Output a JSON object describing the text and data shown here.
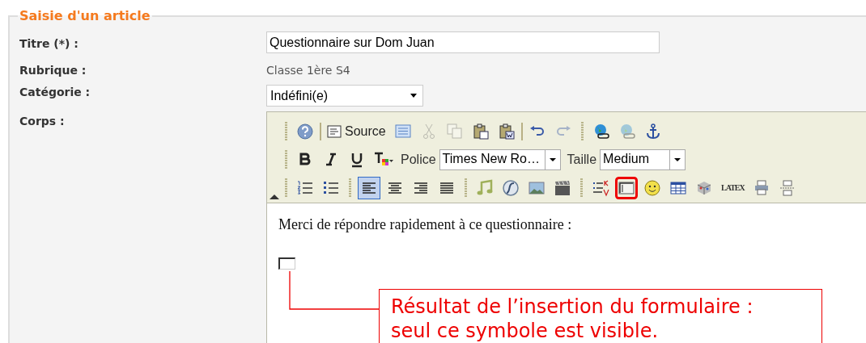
{
  "form": {
    "legend": "Saisie d'un article",
    "fields": [
      {
        "kind": "input",
        "label": "Titre (*) :",
        "value": "Questionnaire sur Dom Juan"
      },
      {
        "kind": "static",
        "label": "Rubrique :",
        "value": "Classe 1ère S4"
      },
      {
        "kind": "select",
        "label": "Catégorie :",
        "value": "Indéfini(e)"
      },
      {
        "kind": "editor",
        "label": "Corps :"
      }
    ]
  },
  "editor": {
    "toolbars": [
      {
        "items": [
          {
            "kind": "grip"
          },
          {
            "kind": "help",
            "on": false,
            "disabled": false,
            "highlighted": false
          },
          {
            "kind": "sep"
          },
          {
            "kind": "source",
            "text": "Source",
            "on": false,
            "disabled": false,
            "highlighted": false
          },
          {
            "kind": "preview",
            "on": false,
            "disabled": false,
            "highlighted": false
          },
          {
            "kind": "cut",
            "on": false,
            "disabled": true,
            "highlighted": false
          },
          {
            "kind": "copy",
            "on": false,
            "disabled": true,
            "highlighted": false
          },
          {
            "kind": "paste",
            "on": false,
            "disabled": false,
            "highlighted": false
          },
          {
            "kind": "pasteword",
            "on": false,
            "disabled": false,
            "highlighted": false
          },
          {
            "kind": "sep"
          },
          {
            "kind": "undo",
            "on": false,
            "disabled": false,
            "highlighted": false
          },
          {
            "kind": "redo",
            "on": false,
            "disabled": true,
            "highlighted": false
          },
          {
            "kind": "grip"
          },
          {
            "kind": "link",
            "on": false,
            "disabled": false,
            "highlighted": false
          },
          {
            "kind": "unlink",
            "on": false,
            "disabled": true,
            "highlighted": false
          },
          {
            "kind": "anchor",
            "on": false,
            "disabled": false,
            "highlighted": false
          }
        ]
      },
      {
        "items": [
          {
            "kind": "grip"
          },
          {
            "kind": "bold",
            "on": false,
            "disabled": false,
            "highlighted": false
          },
          {
            "kind": "italic",
            "on": false,
            "disabled": false,
            "highlighted": false
          },
          {
            "kind": "underline",
            "on": false,
            "disabled": false,
            "highlighted": false
          },
          {
            "kind": "textcolor",
            "on": false,
            "disabled": false,
            "highlighted": false
          },
          {
            "kind": "label",
            "text": "Police"
          },
          {
            "kind": "select",
            "value": "Times New Ro…"
          },
          {
            "kind": "label",
            "text": "Taille"
          },
          {
            "kind": "select",
            "value": "Medium"
          }
        ]
      },
      {
        "items": [
          {
            "kind": "grip"
          },
          {
            "kind": "orderedlist",
            "on": false,
            "disabled": false,
            "highlighted": false
          },
          {
            "kind": "bulletlist",
            "on": false,
            "disabled": false,
            "highlighted": false
          },
          {
            "kind": "grip"
          },
          {
            "kind": "alignleft",
            "on": true,
            "disabled": false,
            "highlighted": false
          },
          {
            "kind": "aligncenter",
            "on": false,
            "disabled": false,
            "highlighted": false
          },
          {
            "kind": "alignright",
            "on": false,
            "disabled": false,
            "highlighted": false
          },
          {
            "kind": "justify",
            "on": false,
            "disabled": false,
            "highlighted": false
          },
          {
            "kind": "grip"
          },
          {
            "kind": "music",
            "on": false,
            "disabled": false,
            "highlighted": false
          },
          {
            "kind": "flash",
            "on": false,
            "disabled": false,
            "highlighted": false
          },
          {
            "kind": "image",
            "on": false,
            "disabled": false,
            "highlighted": false
          },
          {
            "kind": "video",
            "on": false,
            "disabled": false,
            "highlighted": false
          },
          {
            "kind": "grip"
          },
          {
            "kind": "checklist",
            "on": false,
            "disabled": false,
            "highlighted": false
          },
          {
            "kind": "formfield",
            "on": false,
            "disabled": false,
            "highlighted": true
          },
          {
            "kind": "smiley",
            "on": false,
            "disabled": false,
            "highlighted": false
          },
          {
            "kind": "table",
            "on": false,
            "disabled": false,
            "highlighted": false
          },
          {
            "kind": "cube",
            "on": false,
            "disabled": false,
            "highlighted": false
          },
          {
            "kind": "latex",
            "text": "LATEX",
            "on": false,
            "disabled": false,
            "highlighted": false
          },
          {
            "kind": "printer",
            "on": false,
            "disabled": false,
            "highlighted": false
          },
          {
            "kind": "pagebreak",
            "on": false,
            "disabled": false,
            "highlighted": false
          }
        ]
      }
    ],
    "content": "Merci de répondre rapidement à ce questionnaire :"
  },
  "callout": {
    "lines": [
      "Résultat de l’insertion du formulaire :",
      "seul ce symbole est visible."
    ]
  }
}
